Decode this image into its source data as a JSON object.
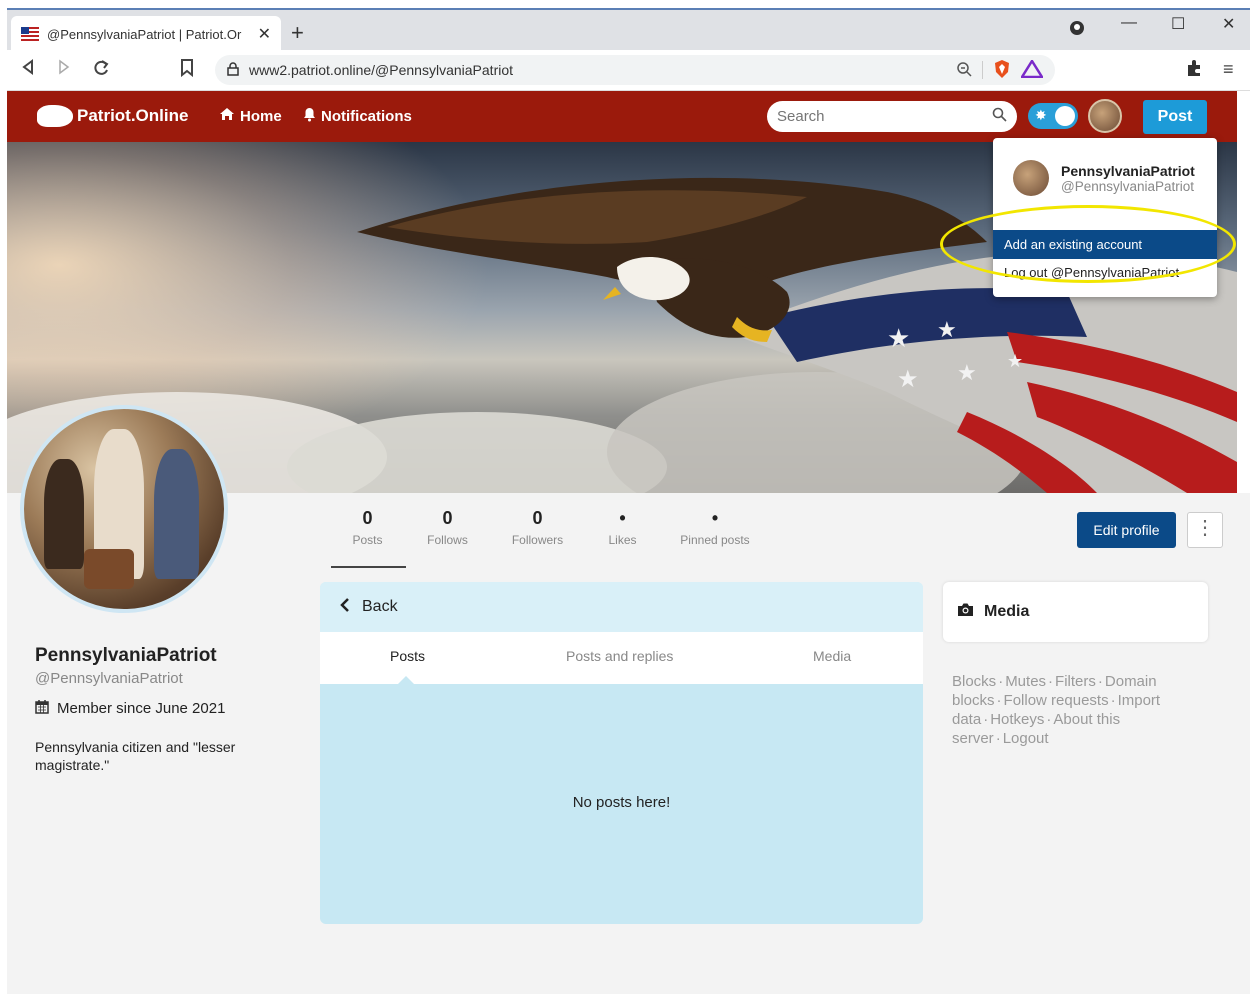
{
  "browser": {
    "tab_title": "@PennsylvaniaPatriot | Patriot.Or",
    "url": "www2.patriot.online/@PennsylvaniaPatriot"
  },
  "navbar": {
    "brand": "Patriot.Online",
    "home_label": "Home",
    "notifications_label": "Notifications",
    "search_placeholder": "Search",
    "post_label": "Post"
  },
  "dropdown": {
    "name": "PennsylvaniaPatriot",
    "handle": "@PennsylvaniaPatriot",
    "add_account": "Add an existing account",
    "logout": "Log out @PennsylvaniaPatriot"
  },
  "stats": [
    {
      "value": "0",
      "label": "Posts"
    },
    {
      "value": "0",
      "label": "Follows"
    },
    {
      "value": "0",
      "label": "Followers"
    },
    {
      "value": "•",
      "label": "Likes"
    },
    {
      "value": "•",
      "label": "Pinned posts"
    }
  ],
  "profile": {
    "edit_label": "Edit profile",
    "name": "PennsylvaniaPatriot",
    "handle": "@PennsylvaniaPatriot",
    "member_since": "Member since June 2021",
    "bio": "Pennsylvania citizen and \"lesser magistrate.\""
  },
  "timeline": {
    "back_label": "Back",
    "tabs": [
      "Posts",
      "Posts and replies",
      "Media"
    ],
    "empty_text": "No posts here!"
  },
  "sidebar": {
    "media_label": "Media",
    "links": [
      "Blocks",
      "Mutes",
      "Filters",
      "Domain blocks",
      "Follow requests",
      "Import data",
      "Hotkeys",
      "About this server",
      "Logout"
    ]
  },
  "colors": {
    "navbar": "#9b1a0c",
    "accent": "#1d9bd8",
    "primary": "#0b4a88",
    "timeline_bg": "#c7e8f3",
    "highlight_ring": "#f2e600"
  }
}
